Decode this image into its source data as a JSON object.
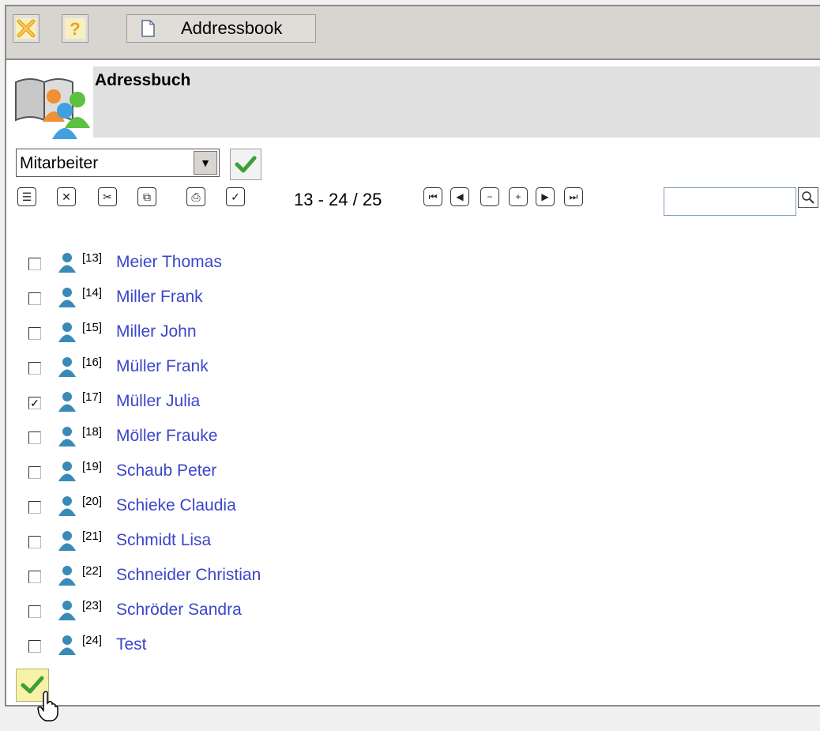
{
  "toolbar": {
    "close_icon": "close-icon",
    "help_icon": "help-icon",
    "tab_label": "Addressbook"
  },
  "header": {
    "title": "Adressbuch",
    "logo_icon": "addressbook-people-icon"
  },
  "filter": {
    "selected": "Mitarbeiter"
  },
  "list_toolbar": {
    "tools": [
      "expand-icon",
      "delete-icon",
      "cut-icon",
      "copy-icon",
      "print-icon",
      "check-icon"
    ],
    "range": "13 - 24 / 25",
    "nav": [
      "first-page-icon",
      "previous-page-icon",
      "collapse-icon",
      "expand-icon",
      "next-page-icon",
      "last-page-icon"
    ],
    "search_value": ""
  },
  "contacts": [
    {
      "id": "[13]",
      "name": "Meier Thomas",
      "checked": false
    },
    {
      "id": "[14]",
      "name": "Miller Frank",
      "checked": false
    },
    {
      "id": "[15]",
      "name": "Miller John",
      "checked": false
    },
    {
      "id": "[16]",
      "name": "Müller Frank",
      "checked": false
    },
    {
      "id": "[17]",
      "name": "Müller Julia",
      "checked": true
    },
    {
      "id": "[18]",
      "name": "Möller Frauke",
      "checked": false
    },
    {
      "id": "[19]",
      "name": "Schaub Peter",
      "checked": false
    },
    {
      "id": "[20]",
      "name": "Schieke Claudia",
      "checked": false
    },
    {
      "id": "[21]",
      "name": "Schmidt Lisa",
      "checked": false
    },
    {
      "id": "[22]",
      "name": "Schneider Christian",
      "checked": false
    },
    {
      "id": "[23]",
      "name": "Schröder Sandra",
      "checked": false
    },
    {
      "id": "[24]",
      "name": "Test",
      "checked": false
    }
  ],
  "colors": {
    "link": "#3b46c8",
    "accent_green": "#3aa03a",
    "toolbar_bg": "#d8d4d0"
  }
}
